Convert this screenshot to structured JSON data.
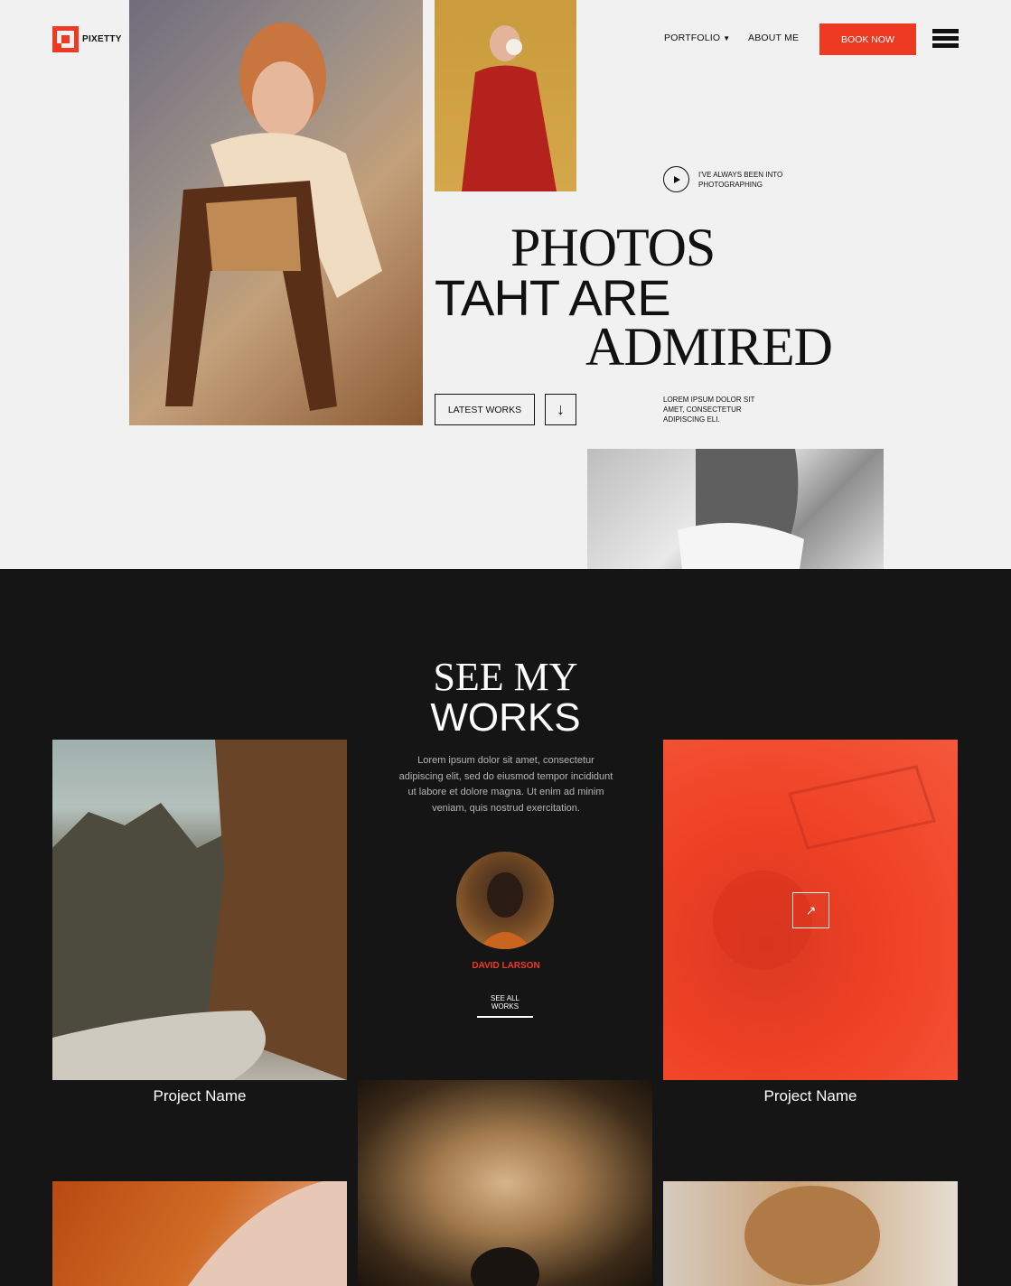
{
  "brand": {
    "name": "PIXETTY",
    "accent": "#ee3a22"
  },
  "nav": {
    "portfolio": "PORTFOLIO",
    "about": "ABOUT ME",
    "book": "BOOK NOW"
  },
  "hero": {
    "tagline": "I'VE ALWAYS BEEN INTO PHOTOGRAPHING",
    "headline": [
      "PHOTOS",
      "TAHT ARE",
      "ADMIRED"
    ],
    "latest_button": "LATEST WORKS",
    "blurb": "LOREM IPSUM DOLOR SIT AMET, CONSECTETUR ADIPISCING ELI."
  },
  "works": {
    "title_line1": "SEE MY",
    "title_line2": "WORKS",
    "description": "Lorem ipsum dolor sit amet, consectetur adipiscing elit, sed do eiusmod tempor incididunt ut labore et dolore magna. Ut enim ad minim veniam, quis nostrud exercitation.",
    "author": "DAVID LARSON",
    "see_all": "SEE ALL WORKS",
    "projects": [
      {
        "name": "Project Name"
      },
      {
        "name": "Project Name"
      }
    ]
  },
  "icons": {
    "play": "play-icon",
    "down": "arrow-down-icon",
    "external": "arrow-up-right-icon",
    "menu": "hamburger-icon"
  }
}
